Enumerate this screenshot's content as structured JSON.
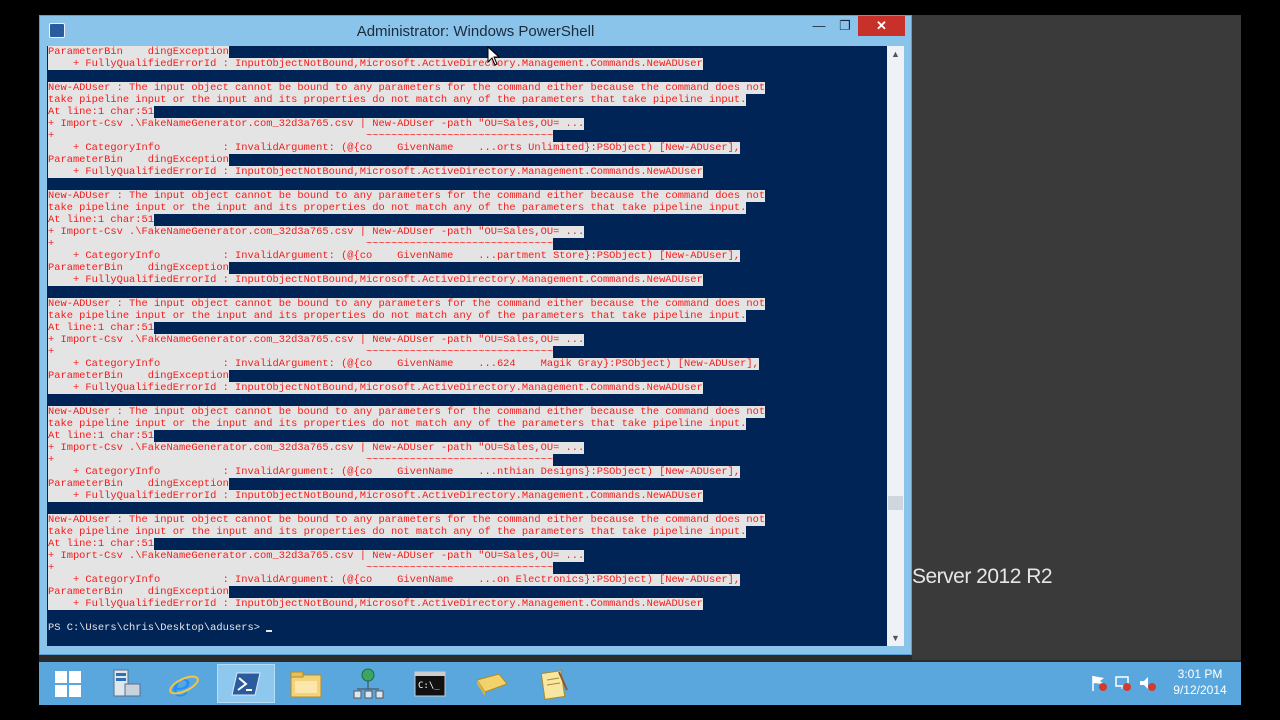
{
  "window": {
    "title": "Administrator: Windows PowerShell",
    "min_label": "—",
    "max_label": "❐",
    "close_label": "✕"
  },
  "background_text": "Server 2012 R2",
  "console_lines": [
    {
      "t": "ParameterBin    dingException",
      "c": "hl"
    },
    {
      "t": "    + FullyQualifiedErrorId : InputObjectNotBound,Microsoft.ActiveDirectory.Management.Commands.NewADUser",
      "c": "hl"
    },
    {
      "t": "",
      "c": "blank"
    },
    {
      "t": "New-ADUser : The input object cannot be bound to any parameters for the command either because the command does not",
      "c": "hl"
    },
    {
      "t": "take pipeline input or the input and its properties do not match any of the parameters that take pipeline input.",
      "c": "hl"
    },
    {
      "t": "At line:1 char:51",
      "c": "hl"
    },
    {
      "t": "+ Import-Csv .\\FakeNameGenerator.com_32d3a765.csv | New-ADUser -path \"OU=Sales,OU= ...",
      "c": "hl"
    },
    {
      "t": "+                                                  ~~~~~~~~~~~~~~~~~~~~~~~~~~~~~~",
      "c": "hl"
    },
    {
      "t": "    + CategoryInfo          : InvalidArgument: (@{co    GivenName    ...orts Unlimited}:PSObject) [New-ADUser],",
      "c": "hl"
    },
    {
      "t": "ParameterBin    dingException",
      "c": "hl"
    },
    {
      "t": "    + FullyQualifiedErrorId : InputObjectNotBound,Microsoft.ActiveDirectory.Management.Commands.NewADUser",
      "c": "hl"
    },
    {
      "t": "",
      "c": "blank"
    },
    {
      "t": "New-ADUser : The input object cannot be bound to any parameters for the command either because the command does not",
      "c": "hl"
    },
    {
      "t": "take pipeline input or the input and its properties do not match any of the parameters that take pipeline input.",
      "c": "hl"
    },
    {
      "t": "At line:1 char:51",
      "c": "hl"
    },
    {
      "t": "+ Import-Csv .\\FakeNameGenerator.com_32d3a765.csv | New-ADUser -path \"OU=Sales,OU= ...",
      "c": "hl"
    },
    {
      "t": "+                                                  ~~~~~~~~~~~~~~~~~~~~~~~~~~~~~~",
      "c": "hl"
    },
    {
      "t": "    + CategoryInfo          : InvalidArgument: (@{co    GivenName    ...partment Store}:PSObject) [New-ADUser],",
      "c": "hl"
    },
    {
      "t": "ParameterBin    dingException",
      "c": "hl"
    },
    {
      "t": "    + FullyQualifiedErrorId : InputObjectNotBound,Microsoft.ActiveDirectory.Management.Commands.NewADUser",
      "c": "hl"
    },
    {
      "t": "",
      "c": "blank"
    },
    {
      "t": "New-ADUser : The input object cannot be bound to any parameters for the command either because the command does not",
      "c": "hl"
    },
    {
      "t": "take pipeline input or the input and its properties do not match any of the parameters that take pipeline input.",
      "c": "hl"
    },
    {
      "t": "At line:1 char:51",
      "c": "hl"
    },
    {
      "t": "+ Import-Csv .\\FakeNameGenerator.com_32d3a765.csv | New-ADUser -path \"OU=Sales,OU= ...",
      "c": "hl"
    },
    {
      "t": "+                                                  ~~~~~~~~~~~~~~~~~~~~~~~~~~~~~~",
      "c": "hl"
    },
    {
      "t": "    + CategoryInfo          : InvalidArgument: (@{co    GivenName    ...624    Magik Gray}:PSObject) [New-ADUser],",
      "c": "hl"
    },
    {
      "t": "ParameterBin    dingException",
      "c": "hl"
    },
    {
      "t": "    + FullyQualifiedErrorId : InputObjectNotBound,Microsoft.ActiveDirectory.Management.Commands.NewADUser",
      "c": "hl"
    },
    {
      "t": "",
      "c": "blank"
    },
    {
      "t": "New-ADUser : The input object cannot be bound to any parameters for the command either because the command does not",
      "c": "hl"
    },
    {
      "t": "take pipeline input or the input and its properties do not match any of the parameters that take pipeline input.",
      "c": "hl"
    },
    {
      "t": "At line:1 char:51",
      "c": "hl"
    },
    {
      "t": "+ Import-Csv .\\FakeNameGenerator.com_32d3a765.csv | New-ADUser -path \"OU=Sales,OU= ...",
      "c": "hl"
    },
    {
      "t": "+                                                  ~~~~~~~~~~~~~~~~~~~~~~~~~~~~~~",
      "c": "hl"
    },
    {
      "t": "    + CategoryInfo          : InvalidArgument: (@{co    GivenName    ...nthian Designs}:PSObject) [New-ADUser],",
      "c": "hl"
    },
    {
      "t": "ParameterBin    dingException",
      "c": "hl"
    },
    {
      "t": "    + FullyQualifiedErrorId : InputObjectNotBound,Microsoft.ActiveDirectory.Management.Commands.NewADUser",
      "c": "hl"
    },
    {
      "t": "",
      "c": "blank"
    },
    {
      "t": "New-ADUser : The input object cannot be bound to any parameters for the command either because the command does not",
      "c": "hl"
    },
    {
      "t": "take pipeline input or the input and its properties do not match any of the parameters that take pipeline input.",
      "c": "hl"
    },
    {
      "t": "At line:1 char:51",
      "c": "hl"
    },
    {
      "t": "+ Import-Csv .\\FakeNameGenerator.com_32d3a765.csv | New-ADUser -path \"OU=Sales,OU= ...",
      "c": "hl"
    },
    {
      "t": "+                                                  ~~~~~~~~~~~~~~~~~~~~~~~~~~~~~~",
      "c": "hl"
    },
    {
      "t": "    + CategoryInfo          : InvalidArgument: (@{co    GivenName    ...on Electronics}:PSObject) [New-ADUser],",
      "c": "hl"
    },
    {
      "t": "ParameterBin    dingException",
      "c": "hl"
    },
    {
      "t": "    + FullyQualifiedErrorId : InputObjectNotBound,Microsoft.ActiveDirectory.Management.Commands.NewADUser",
      "c": "hl"
    },
    {
      "t": "",
      "c": "blank"
    }
  ],
  "prompt": "PS C:\\Users\\chris\\Desktop\\adusers> ",
  "taskbar": {
    "items": [
      {
        "name": "start-button-icon"
      },
      {
        "name": "server-manager-icon"
      },
      {
        "name": "internet-explorer-icon"
      },
      {
        "name": "powershell-icon"
      },
      {
        "name": "file-explorer-icon"
      },
      {
        "name": "network-icon"
      },
      {
        "name": "command-prompt-icon"
      },
      {
        "name": "folder-icon"
      },
      {
        "name": "notepad-icon"
      }
    ],
    "clock_time": "3:01 PM",
    "clock_date": "9/12/2014"
  },
  "colors": {
    "console_bg": "#012456",
    "error_text": "#ff2020",
    "taskbar": "#5aa7dd"
  }
}
